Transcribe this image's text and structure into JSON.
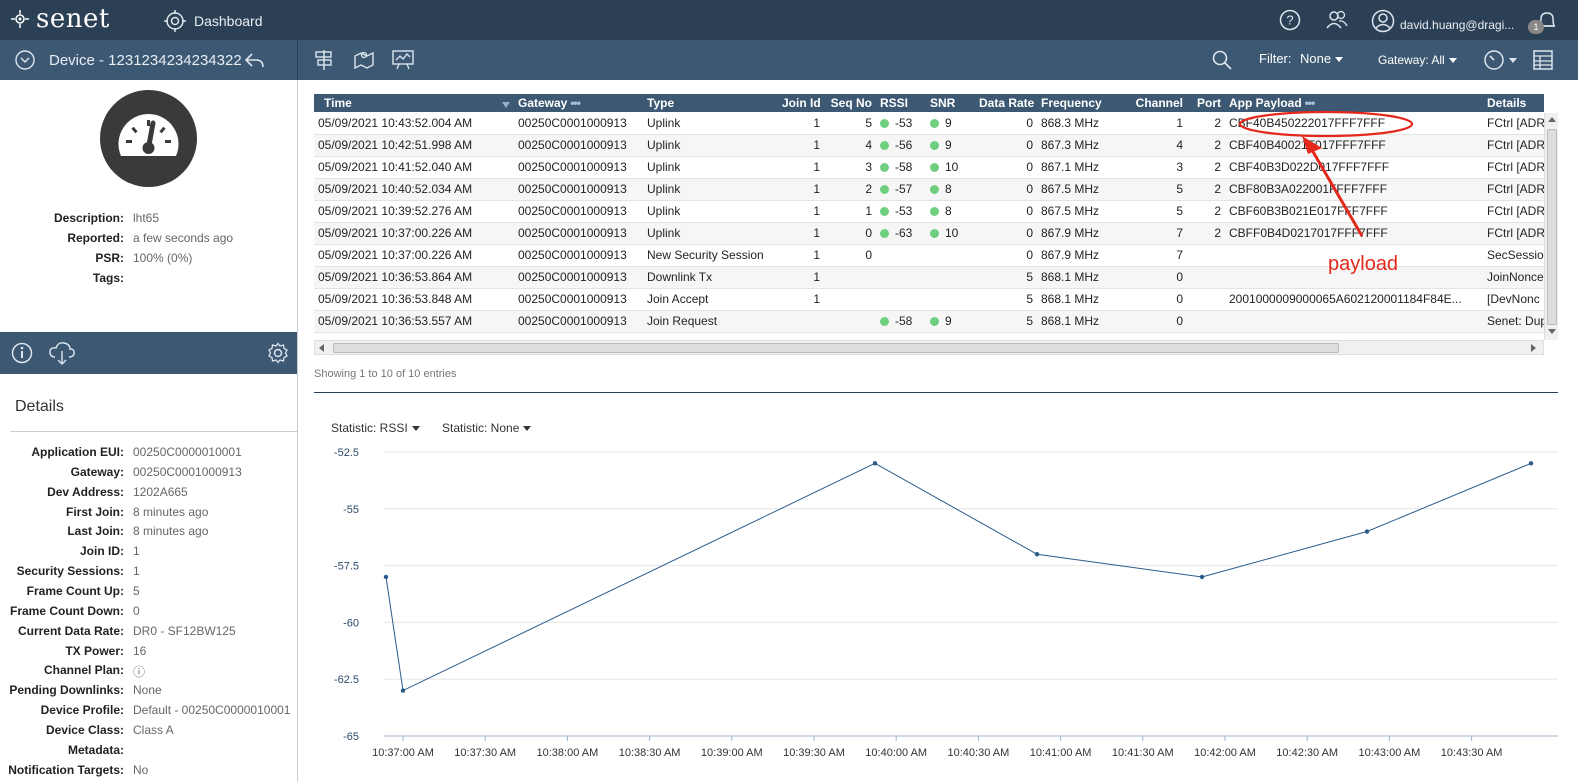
{
  "topbar": {
    "logo": "senet",
    "dashboard_label": "Dashboard",
    "user": "david.huang@dragi...",
    "notification_count": "1"
  },
  "subbar": {
    "device_title": "Device - 1231234234234322",
    "filter_label": "Filter:",
    "filter_value": "None",
    "gateway_label": "Gateway: All"
  },
  "summary": [
    {
      "key": "Description:",
      "value": "lht65"
    },
    {
      "key": "Reported:",
      "value": "a few seconds ago"
    },
    {
      "key": "PSR:",
      "value": "100% (0%)"
    },
    {
      "key": "Tags:",
      "value": ""
    }
  ],
  "details_title": "Details",
  "details": [
    {
      "key": "Application EUI:",
      "value": "00250C0000010001"
    },
    {
      "key": "Gateway:",
      "value": "00250C0001000913"
    },
    {
      "key": "Dev Address:",
      "value": "1202A665"
    },
    {
      "key": "First Join:",
      "value": "8 minutes ago"
    },
    {
      "key": "Last Join:",
      "value": "8 minutes ago"
    },
    {
      "key": "Join ID:",
      "value": "1"
    },
    {
      "key": "Security Sessions:",
      "value": "1"
    },
    {
      "key": "Frame Count Up:",
      "value": "5"
    },
    {
      "key": "Frame Count Down:",
      "value": "0"
    },
    {
      "key": "Current Data Rate:",
      "value": "DR0 - SF12BW125"
    },
    {
      "key": "TX Power:",
      "value": "16"
    },
    {
      "key": "Channel Plan:",
      "value": "ⓘ"
    },
    {
      "key": "Pending Downlinks:",
      "value": "None"
    },
    {
      "key": "Device Profile:",
      "value": "Default - 00250C0000010001"
    },
    {
      "key": "Device Class:",
      "value": "Class A"
    },
    {
      "key": "Metadata:",
      "value": ""
    },
    {
      "key": "Notification Targets:",
      "value": "No"
    }
  ],
  "table": {
    "columns": [
      "Time",
      "Gateway",
      "Type",
      "Join Id",
      "Seq No",
      "RSSI",
      "SNR",
      "Data Rate",
      "Frequency",
      "Channel",
      "Port",
      "App Payload",
      "Details"
    ],
    "rows": [
      [
        "05/09/2021 10:43:52.004 AM",
        "00250C0001000913",
        "Uplink",
        "1",
        "5",
        "-53",
        "9",
        "0",
        "868.3 MHz",
        "1",
        "2",
        "CBF40B450222017FFF7FFF",
        "FCtrl [ADR"
      ],
      [
        "05/09/2021 10:42:51.998 AM",
        "00250C0001000913",
        "Uplink",
        "1",
        "4",
        "-56",
        "9",
        "0",
        "867.3 MHz",
        "4",
        "2",
        "CBF40B40021F017FFF7FFF",
        "FCtrl [ADR"
      ],
      [
        "05/09/2021 10:41:52.040 AM",
        "00250C0001000913",
        "Uplink",
        "1",
        "3",
        "-58",
        "10",
        "0",
        "867.1 MHz",
        "3",
        "2",
        "CBF40B3D022D017FFF7FFF",
        "FCtrl [ADR"
      ],
      [
        "05/09/2021 10:40:52.034 AM",
        "00250C0001000913",
        "Uplink",
        "1",
        "2",
        "-57",
        "8",
        "0",
        "867.5 MHz",
        "5",
        "2",
        "CBF80B3A022001FFFF7FFF",
        "FCtrl [ADR"
      ],
      [
        "05/09/2021 10:39:52.276 AM",
        "00250C0001000913",
        "Uplink",
        "1",
        "1",
        "-53",
        "8",
        "0",
        "867.5 MHz",
        "5",
        "2",
        "CBF60B3B021E017FFF7FFF",
        "FCtrl [ADR"
      ],
      [
        "05/09/2021 10:37:00.226 AM",
        "00250C0001000913",
        "Uplink",
        "1",
        "0",
        "-63",
        "10",
        "0",
        "867.9 MHz",
        "7",
        "2",
        "CBFF0B4D0217017FFF7FFF",
        "FCtrl [ADR"
      ],
      [
        "05/09/2021 10:37:00.226 AM",
        "00250C0001000913",
        "New Security Session",
        "1",
        "0",
        "",
        "",
        "0",
        "867.9 MHz",
        "7",
        "",
        "",
        "SecSessio"
      ],
      [
        "05/09/2021 10:36:53.864 AM",
        "00250C0001000913",
        "Downlink Tx",
        "1",
        "",
        "",
        "",
        "5",
        "868.1 MHz",
        "0",
        "",
        "",
        "JoinNonce"
      ],
      [
        "05/09/2021 10:36:53.848 AM",
        "00250C0001000913",
        "Join Accept",
        "1",
        "",
        "",
        "",
        "5",
        "868.1 MHz",
        "0",
        "",
        "2001000009000065A602120001184F84E...",
        "[DevNonc"
      ],
      [
        "05/09/2021 10:36:53.557 AM",
        "00250C0001000913",
        "Join Request",
        "",
        "",
        "-58",
        "9",
        "5",
        "868.1 MHz",
        "0",
        "",
        "",
        "Senet: Dup"
      ]
    ],
    "showing": "Showing 1 to 10 of 10 entries"
  },
  "statistics": {
    "stat1": "Statistic: RSSI",
    "stat2": "Statistic: None"
  },
  "annotation": "payload",
  "colors": {
    "header_bg": "#2b3f55",
    "subbar_bg": "#3d5873",
    "line": "#2b5b8a",
    "dot_green": "#6fcf7f",
    "annot_red": "#e4281c"
  },
  "chart_data": {
    "type": "line",
    "x": [
      "10:37:00",
      "10:37:00",
      "10:39:52",
      "10:40:52",
      "10:41:52",
      "10:42:51",
      "10:43:52"
    ],
    "values": [
      -58,
      -63,
      -53,
      -57,
      -58,
      -56,
      -53
    ],
    "ylim": [
      -65,
      -52.5
    ],
    "y_ticks": [
      "-52.5",
      "-55",
      "-57.5",
      "-60",
      "-62.5",
      "-65"
    ],
    "x_ticks": [
      "10:37:00 AM",
      "10:37:30 AM",
      "10:38:00 AM",
      "10:38:30 AM",
      "10:39:00 AM",
      "10:39:30 AM",
      "10:40:00 AM",
      "10:40:30 AM",
      "10:41:00 AM",
      "10:41:30 AM",
      "10:42:00 AM",
      "10:42:30 AM",
      "10:43:00 AM",
      "10:43:30 AM"
    ],
    "grid": true
  }
}
